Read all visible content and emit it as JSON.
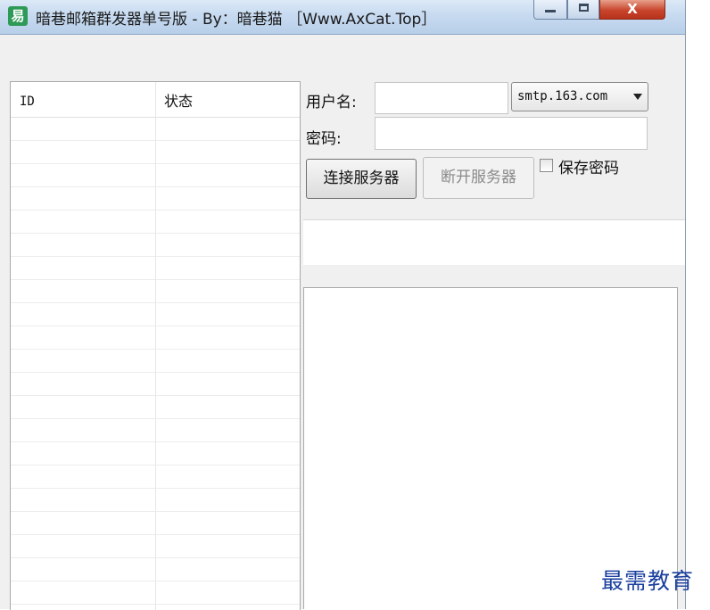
{
  "window": {
    "title": "暗巷邮箱群发器单号版 - By：暗巷猫 ［Www.AxCat.Top］",
    "app_icon_glyph": "易",
    "close_glyph": "X"
  },
  "list": {
    "columns": [
      "ID",
      "状态"
    ],
    "rows": []
  },
  "form": {
    "username_label": "用户名:",
    "username_value": "",
    "smtp_selected": "smtp.163.com",
    "password_label": "密码:",
    "password_value": "",
    "connect_label": "连接服务器",
    "disconnect_label": "断开服务器",
    "save_password_label": "保存密码",
    "save_password_checked": false
  },
  "status_text": "",
  "log_text": "",
  "watermark": "最需教育"
}
